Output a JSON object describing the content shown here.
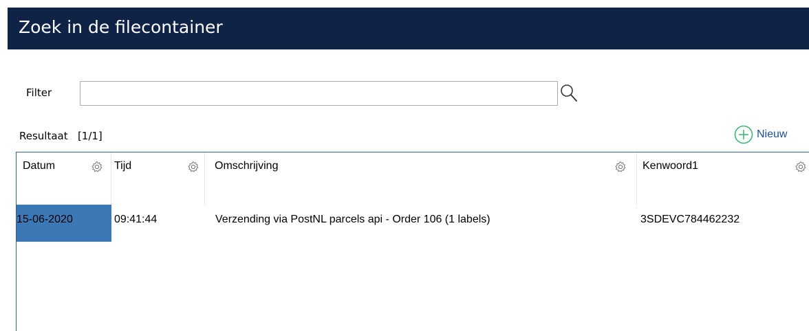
{
  "window": {
    "title": "Zoek in de filecontainer"
  },
  "filter": {
    "label": "Filter",
    "value": "",
    "placeholder": ""
  },
  "results": {
    "label": "Resultaat",
    "page_indicator": "[1/1]",
    "new_label": "Nieuw"
  },
  "table": {
    "columns": [
      {
        "label": "Datum"
      },
      {
        "label": "Tijd"
      },
      {
        "label": "Omschrijving"
      },
      {
        "label": "Kenwoord1"
      }
    ],
    "rows": [
      {
        "datum": "15-06-2020",
        "tijd": "09:41:44",
        "omschrijving": "Verzending via PostNL parcels api - Order 106 (1 labels)",
        "kenwoord1": "3SDEVC784462232",
        "selected_column": "datum"
      }
    ]
  },
  "icons": {
    "search": "magnifier-icon",
    "new": "plus-circle-icon",
    "column_settings": "gear-icon"
  },
  "colors": {
    "titlebar": "#0f2346",
    "selection": "#3d78b6",
    "grid_border": "#2f5f9e",
    "new_plus": "#3cb878",
    "new_text": "#1e4c9a"
  }
}
